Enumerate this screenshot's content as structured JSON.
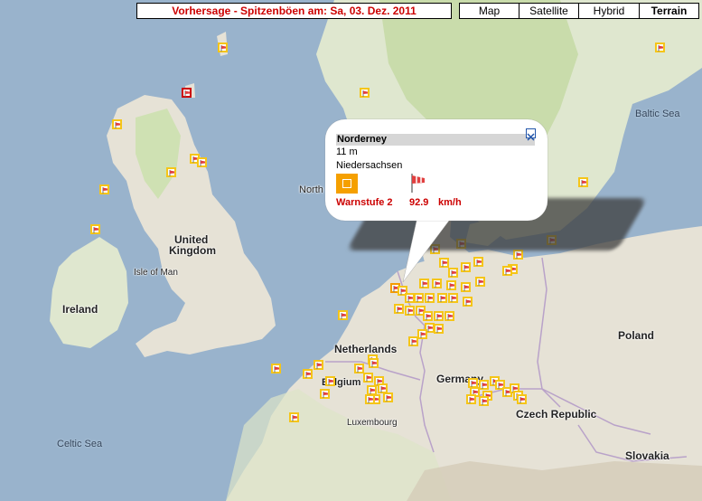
{
  "header": {
    "title": "Vorhersage - Spitzenböen am: Sa, 03. Dez. 2011",
    "map_types": [
      {
        "label": "Map",
        "active": false
      },
      {
        "label": "Satellite",
        "active": false
      },
      {
        "label": "Hybrid",
        "active": false
      },
      {
        "label": "Terrain",
        "active": true
      }
    ]
  },
  "labels": {
    "north": "North",
    "baltic_sea": "Baltic Sea",
    "united": "United",
    "kingdom": "Kingdom",
    "isle_of_man": "Isle of Man",
    "ireland": "Ireland",
    "netherlands": "Netherlands",
    "belgium": "Belgium",
    "luxembourg": "Luxembourg",
    "germany": "Germany",
    "poland": "Poland",
    "czech_republic": "Czech Republic",
    "slovakia": "Slovakia",
    "celtic_sea": "Celtic Sea"
  },
  "popup": {
    "station": "Norderney",
    "elevation": "11 m",
    "state": "Niedersachsen",
    "warning": "Warnstufe 2",
    "gust_value": "92.9",
    "gust_unit": "km/h"
  },
  "colors": {
    "water": "#99b3cc",
    "land": "#e6e2d6",
    "forest": "#cfe1b3",
    "marker_normal": "#f5c518",
    "marker_orange": "#f59b00",
    "marker_red": "#cc0000",
    "warning_text": "#cc0000"
  }
}
